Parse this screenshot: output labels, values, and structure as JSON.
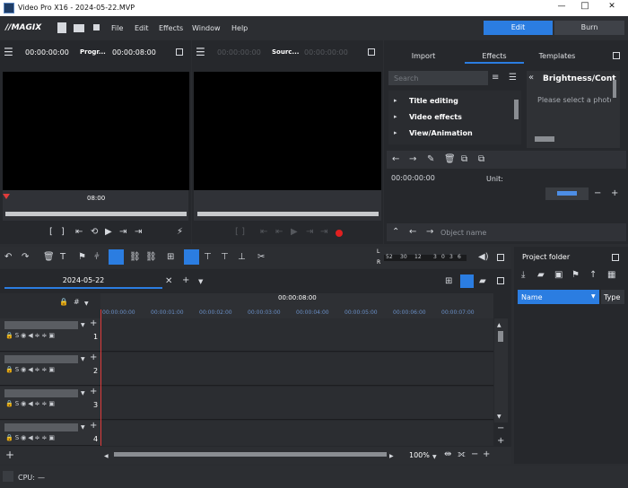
{
  "window": {
    "title": "Video Pro X16 - 2024-05-22.MVP",
    "controls": [
      "—",
      "□",
      "✕"
    ]
  },
  "menu": {
    "logo": "//MAGIX",
    "items": [
      "File",
      "Edit",
      "Effects",
      "Window",
      "Help"
    ],
    "mode_edit": "Edit",
    "mode_burn": "Burn"
  },
  "program_monitor": {
    "timecode_start": "00:00:00:00",
    "label": "Progr...",
    "timecode_end": "00:00:08:00",
    "ruler_label": "08:00"
  },
  "source_monitor": {
    "timecode_start": "00:00:00:00",
    "label": "Sourc...",
    "timecode_end": "00:00:00:00"
  },
  "media_pool": {
    "tabs": [
      "Import",
      "Effects",
      "Templates"
    ],
    "active_tab": "Effects",
    "search_placeholder": "Search",
    "effect_items": [
      "Title editing",
      "Video effects",
      "View/Animation"
    ],
    "preview_title": "Brightness/Cont",
    "preview_text": "Please select a photo",
    "timecode": "00:00:00:00",
    "unit_label": "Unit:",
    "object_name_placeholder": "Object name"
  },
  "meter": {
    "labels_top": "L",
    "labels_bottom": "R",
    "scale": [
      "52",
      "30",
      "12",
      "3",
      "0",
      "3",
      "6"
    ]
  },
  "arranger": {
    "tab_label": "2024-05-22",
    "ruler_time": "00:00:08:00",
    "ruler_ticks": [
      "00:00:00:00",
      "00:00:01:00",
      "00:00:02:00",
      "00:00:03:00",
      "00:00:04:00",
      "00:00:05:00",
      "00:00:06:00",
      "00:00:07:00"
    ],
    "tracks": [
      {
        "number": "1",
        "controls": "S"
      },
      {
        "number": "2",
        "controls": "S"
      },
      {
        "number": "3",
        "controls": "S"
      },
      {
        "number": "4",
        "controls": "S"
      }
    ],
    "zoom": "100%"
  },
  "project_folder": {
    "title": "Project folder",
    "col_name": "Name",
    "col_type": "Type"
  },
  "status": {
    "cpu_label": "CPU:",
    "cpu_value": "—"
  },
  "colors": {
    "accent": "#2b7de1",
    "playhead": "#e03b3b",
    "record": "#e02020"
  }
}
